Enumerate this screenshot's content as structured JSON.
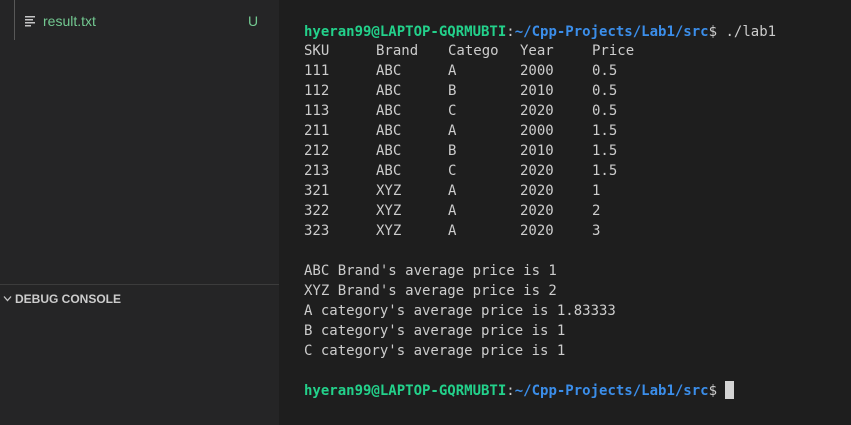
{
  "explorer": {
    "file": {
      "name": "result.txt",
      "status": "U",
      "icon": "lines-icon"
    }
  },
  "debug_console": {
    "title": "DEBUG CONSOLE"
  },
  "terminal": {
    "prompt_user": "hyeran99@LAPTOP-GQRMUBTI",
    "prompt_colon": ":",
    "prompt_path": "~/Cpp-Projects/Lab1/src",
    "prompt_symbol": "$",
    "command": " ./lab1",
    "table_header": [
      "SKU",
      "Brand",
      "Catego",
      "Year",
      "Price"
    ],
    "table_rows": [
      [
        "111",
        "ABC",
        "A",
        "2000",
        "0.5"
      ],
      [
        "112",
        "ABC",
        "B",
        "2010",
        "0.5"
      ],
      [
        "113",
        "ABC",
        "C",
        "2020",
        "0.5"
      ],
      [
        "211",
        "ABC",
        "A",
        "2000",
        "1.5"
      ],
      [
        "212",
        "ABC",
        "B",
        "2010",
        "1.5"
      ],
      [
        "213",
        "ABC",
        "C",
        "2020",
        "1.5"
      ],
      [
        "321",
        "XYZ",
        "A",
        "2020",
        "1"
      ],
      [
        "322",
        "XYZ",
        "A",
        "2020",
        "2"
      ],
      [
        "323",
        "XYZ",
        "A",
        "2020",
        "3"
      ]
    ],
    "summary_lines": [
      "ABC Brand's average price is 1",
      "XYZ Brand's average price is 2",
      "A category's average price is 1.83333",
      "B category's average price is 1",
      "C category's average price is 1"
    ],
    "colors": {
      "user": "#23d18b",
      "path": "#3b8eea",
      "text": "#cccccc",
      "background": "#1e1e1e"
    }
  }
}
